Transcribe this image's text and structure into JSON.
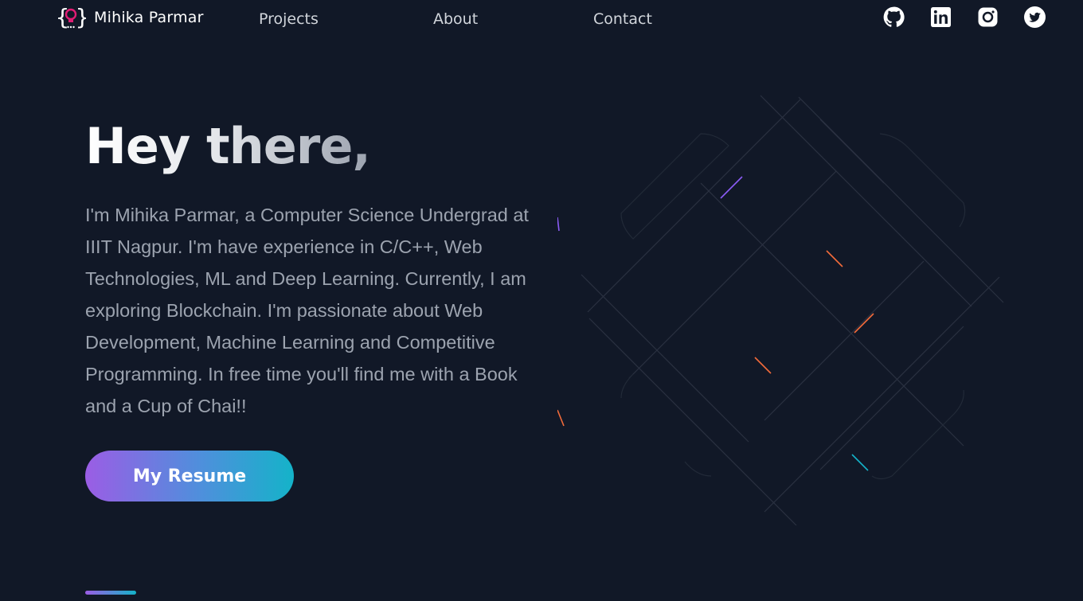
{
  "brand": {
    "name": "Mihika Parmar",
    "logo_icon": "lightbulb-code-icon",
    "logo_color": "#e11d74"
  },
  "nav": {
    "projects": "Projects",
    "about": "About",
    "contact": "Contact"
  },
  "social": [
    "github-icon",
    "linkedin-icon",
    "instagram-icon",
    "twitter-icon"
  ],
  "hero": {
    "title": "Hey there,",
    "bio": "I'm Mihika Parmar, a Computer Science Undergrad at IIIT Nagpur. I'm have experience in C/C++, Web Technologies, ML and Deep Learning. Currently, I am exploring Blockchain. I'm passionate about Web Development, Machine Learning and Competitive Programming. In free time you'll find me with a Book and a Cup of Chai!!",
    "resume_button": "My Resume"
  },
  "colors": {
    "background": "#111827",
    "gradient_start": "#9b5de5",
    "gradient_end": "#14b3c9",
    "text_muted": "#9ca3af",
    "accent_orange": "#f26b3a"
  }
}
